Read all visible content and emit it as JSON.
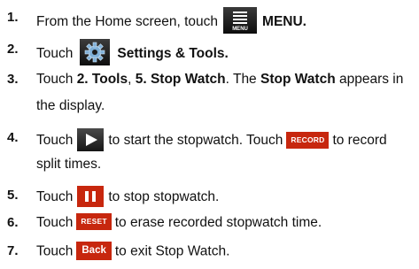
{
  "steps": [
    {
      "num": "1.",
      "pre": "From the Home screen, touch",
      "post": "MENU."
    },
    {
      "num": "2.",
      "pre": "Touch",
      "post": "Settings & Tools."
    },
    {
      "num": "3.",
      "line1_a": "Touch",
      "line1_b": "2. Tools",
      "line1_c": ",",
      "line1_d": "5. Stop Watch",
      "line1_e": ". The",
      "line1_f": "Stop Watch",
      "line1_g": "appears in",
      "line2": "the display."
    },
    {
      "num": "4.",
      "pre": "Touch",
      "mid": "to start the stopwatch. Touch",
      "post": "to record",
      "line2": "split times."
    },
    {
      "num": "5.",
      "pre": "Touch",
      "post": "to stop stopwatch."
    },
    {
      "num": "6.",
      "pre": "Touch",
      "post": "to erase recorded stopwatch time."
    },
    {
      "num": "7.",
      "pre": "Touch",
      "post": "to exit Stop Watch."
    }
  ],
  "icons": {
    "menu_label": "MENU",
    "record_label": "RECORD",
    "reset_label": "RESET",
    "back_label": "Back"
  },
  "colors": {
    "accent_red": "#c7270e",
    "icon_dark": "#1a1a1a"
  }
}
